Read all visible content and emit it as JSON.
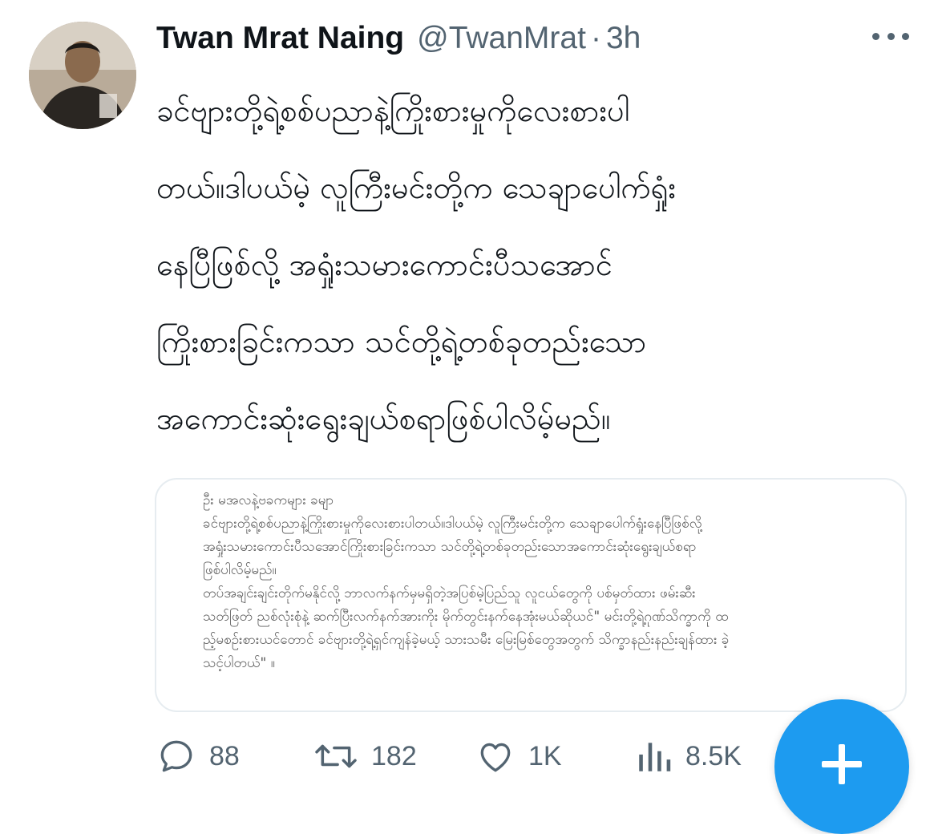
{
  "author": {
    "name": "Twan Mrat Naing",
    "handle": "@TwanMrat",
    "separator": "·",
    "time": "3h"
  },
  "tweet": {
    "lines": [
      "ခင်ဗျားတို့ရဲ့စစ်ပညာနဲ့ကြိုးစားမှုကိုလေးစားပါ",
      "တယ်။ဒါပယ်မဲ့ လူကြီးမင်းတို့က သေချာပေါက်ရှုံး",
      "နေပြီဖြစ်လို့ အရှုံးသမားကောင်းပီသအောင်",
      "ကြိုးစားခြင်းကသာ သင်တို့ရဲ့တစ်ခုတည်းသော",
      "အကောင်းဆုံးရွေးချယ်စရာဖြစ်ပါလိမ့်မည်။"
    ]
  },
  "quoted_image": {
    "lines": [
      "ဦး မအလနဲ့ဗခကများ ခမျာ",
      "ခင်ဗျားတို့ရဲ့စစ်ပညာနဲ့ကြိုးစားမှုကိုလေးစားပါတယ်။ဒါပယ်မဲ့ လူကြီးမင်းတို့က သေချာပေါက်ရှုံးနေပြီဖြစ်လို့",
      "အရှုံးသမားကောင်းပီသအောင်ကြိုးစားခြင်းကသာ သင်တို့ရဲ့တစ်ခုတည်းသောအကောင်းဆုံးရွေးချယ်စရာ",
      "ဖြစ်ပါလိမ့်မည်။",
      "တပ်အချင်းချင်းတိုက်မနိုင်လို့ ဘာလက်နက်မှမရှိတဲ့အပြစ်မဲ့ပြည်သူ လူငယ်တွေကို ပစ်မှတ်ထား ဖမ်းဆီး",
      "သတ်ဖြတ် ညစ်လုံးစုံနဲ့ ဆက်ပြီးလက်နက်အားကိုး မိုက်တွင်းနက်နေအုံးမယ်ဆိုယင်\" မင်းတို့ရဲ့ဂုဏ်သိက္ခာကို ထ",
      "ည့်မစဉ်းစားယင်တောင် ခင်ဗျားတို့ရဲ့ရှင်ကျန်ခဲ့မယ့် သားသမီး မြေးမြစ်တွေအတွက် သိက္ခာနည်းနည်းချန်ထား ခဲ့",
      "သင့်ပါတယ်\" ။"
    ]
  },
  "actions": {
    "reply": {
      "icon": "reply-icon",
      "count": "88"
    },
    "retweet": {
      "icon": "retweet-icon",
      "count": "182"
    },
    "like": {
      "icon": "heart-icon",
      "count": "1K"
    },
    "views": {
      "icon": "views-icon",
      "count": "8.5K"
    }
  },
  "compose": {
    "icon": "plus-icon"
  },
  "colors": {
    "accent": "#1d9bf0",
    "text": "#0f1419",
    "muted": "#536471"
  }
}
